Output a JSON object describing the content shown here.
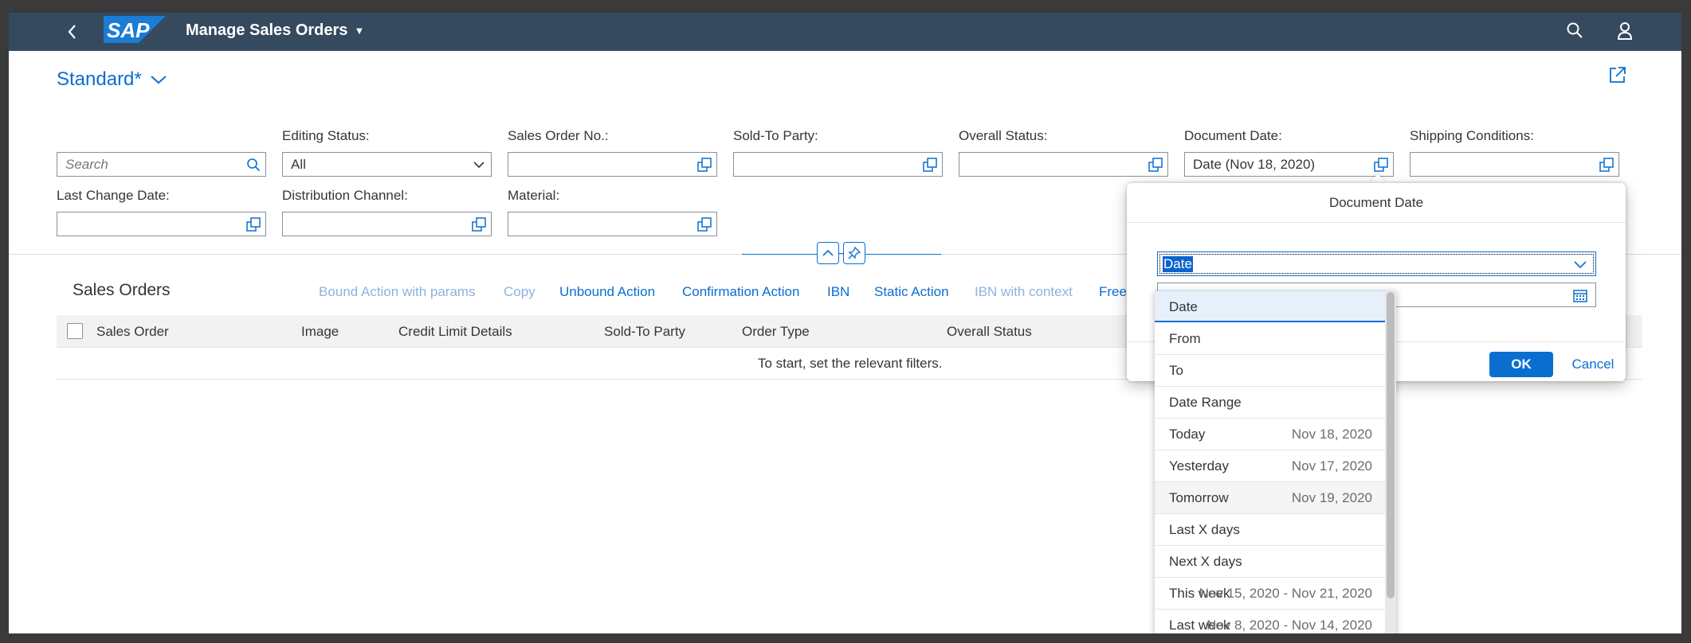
{
  "shell": {
    "back_label": "Back",
    "logo_text": "SAP",
    "app_title": "Manage Sales Orders",
    "colors": {
      "shell_bg": "#354a5f",
      "accent": "#0a6ed1",
      "logo_blue": "#1b7bd5"
    }
  },
  "variant": {
    "title": "Standard*"
  },
  "filters": {
    "search_placeholder": "Search",
    "editing_status_label": "Editing Status:",
    "editing_status_value": "All",
    "sales_order_no_label": "Sales Order No.:",
    "sold_to_party_label": "Sold-To Party:",
    "overall_status_label": "Overall Status:",
    "document_date_label": "Document Date:",
    "document_date_value": "Date (Nov 18, 2020)",
    "shipping_conditions_label": "Shipping Conditions:",
    "last_change_date_label": "Last Change Date:",
    "distribution_channel_label": "Distribution Channel:",
    "material_label": "Material:"
  },
  "table": {
    "title": "Sales Orders",
    "actions": [
      {
        "label": "Bound Action with params",
        "enabled": false
      },
      {
        "label": "Copy",
        "enabled": false
      },
      {
        "label": "Unbound Action",
        "enabled": true
      },
      {
        "label": "Confirmation Action",
        "enabled": true
      },
      {
        "label": "IBN",
        "enabled": true
      },
      {
        "label": "Static Action",
        "enabled": true
      },
      {
        "label": "IBN with context",
        "enabled": false
      },
      {
        "label": "Free",
        "enabled": true
      }
    ],
    "columns": [
      "Sales Order",
      "Image",
      "Credit Limit Details",
      "Sold-To Party",
      "Order Type",
      "Overall Status"
    ],
    "no_data_text": "To start, set the relevant filters."
  },
  "popover": {
    "title": "Document Date",
    "operator_value": "Date",
    "ok_label": "OK",
    "cancel_label": "Cancel"
  },
  "dropdown": {
    "items": [
      {
        "label": "Date",
        "value": ""
      },
      {
        "label": "From",
        "value": ""
      },
      {
        "label": "To",
        "value": ""
      },
      {
        "label": "Date Range",
        "value": ""
      },
      {
        "label": "Today",
        "value": "Nov 18, 2020"
      },
      {
        "label": "Yesterday",
        "value": "Nov 17, 2020"
      },
      {
        "label": "Tomorrow",
        "value": "Nov 19, 2020"
      },
      {
        "label": "Last X days",
        "value": ""
      },
      {
        "label": "Next X days",
        "value": ""
      },
      {
        "label": "This week",
        "value": "Nov 15, 2020 - Nov 21, 2020"
      },
      {
        "label": "Last week",
        "value": "Nov 8, 2020 - Nov 14, 2020"
      }
    ]
  }
}
